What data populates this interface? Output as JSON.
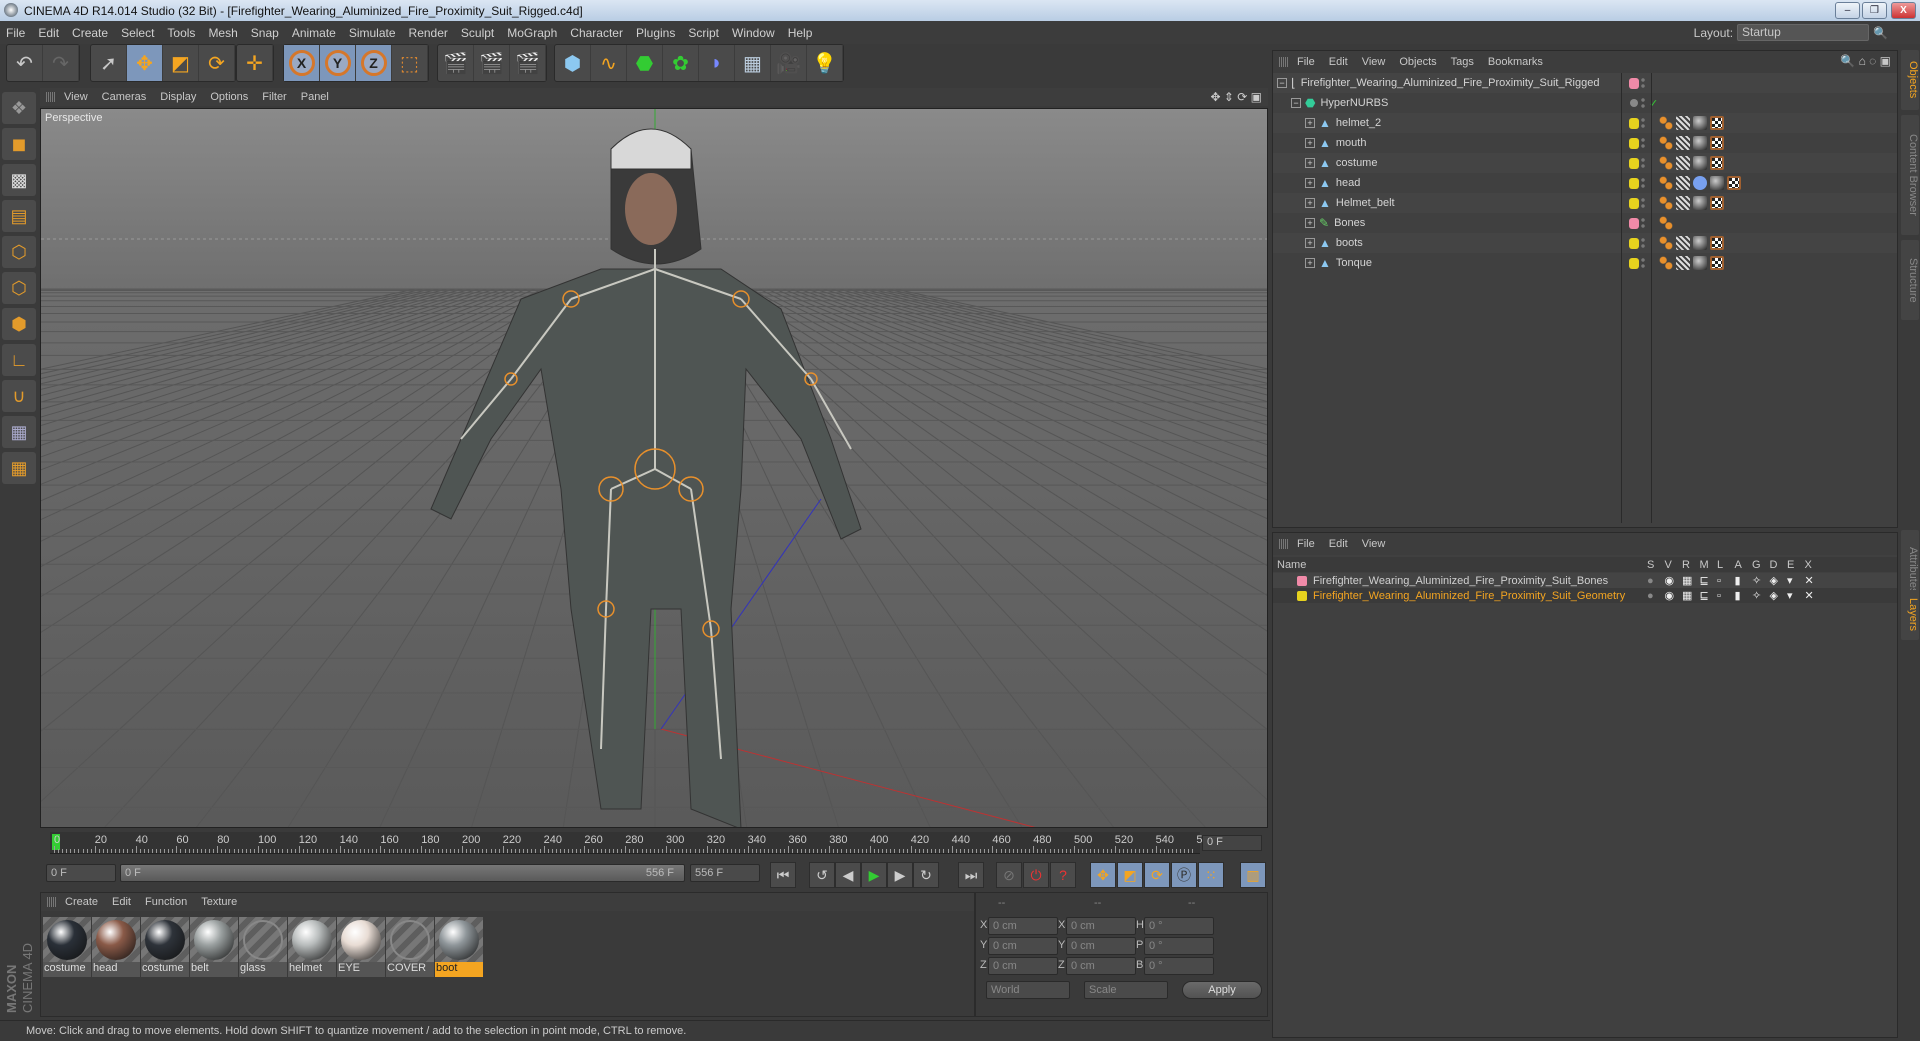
{
  "window": {
    "title": "CINEMA 4D R14.014 Studio (32 Bit) - [Firefighter_Wearing_Aluminized_Fire_Proximity_Suit_Rigged.c4d]",
    "minimize": "‒",
    "restore": "❐",
    "close": "X"
  },
  "menu": [
    "File",
    "Edit",
    "Create",
    "Select",
    "Tools",
    "Mesh",
    "Snap",
    "Animate",
    "Simulate",
    "Render",
    "Sculpt",
    "MoGraph",
    "Character",
    "Plugins",
    "Script",
    "Window",
    "Help"
  ],
  "layout": {
    "label": "Layout:",
    "value": "Startup"
  },
  "toolbar": {
    "axes": [
      "X",
      "Y",
      "Z"
    ]
  },
  "viewport": {
    "menu": [
      "View",
      "Cameras",
      "Display",
      "Options",
      "Filter",
      "Panel"
    ],
    "label": "Perspective"
  },
  "timeline": {
    "ticks": [
      "0",
      "20",
      "40",
      "60",
      "80",
      "100",
      "120",
      "140",
      "160",
      "180",
      "200",
      "220",
      "240",
      "260",
      "280",
      "300",
      "320",
      "340",
      "360",
      "380",
      "400",
      "420",
      "440",
      "460",
      "480",
      "500",
      "520",
      "540",
      "5"
    ],
    "current": "0 F",
    "start": "0 F",
    "range_start": "0 F",
    "range_end": "556 F",
    "end": "556 F"
  },
  "materials": {
    "menu": [
      "Create",
      "Edit",
      "Function",
      "Texture"
    ],
    "items": [
      {
        "name": "costume",
        "color": "#2a3038"
      },
      {
        "name": "head",
        "color": "#8a5a48"
      },
      {
        "name": "costume",
        "color": "#2e333a"
      },
      {
        "name": "belt",
        "color": "#9aa0a0"
      },
      {
        "name": "glass",
        "color": ""
      },
      {
        "name": "helmet",
        "color": "#b8bcbc"
      },
      {
        "name": "EYE",
        "color": "#e8dcd4"
      },
      {
        "name": "COVER",
        "color": ""
      },
      {
        "name": "boot",
        "color": "#8f969a",
        "selected": true
      }
    ]
  },
  "coords": {
    "headers": [
      "--",
      "--",
      "--"
    ],
    "rows": [
      {
        "a": "X",
        "av": "0 cm",
        "b": "X",
        "bv": "0 cm",
        "c": "H",
        "cv": "0 °"
      },
      {
        "a": "Y",
        "av": "0 cm",
        "b": "Y",
        "bv": "0 cm",
        "c": "P",
        "cv": "0 °"
      },
      {
        "a": "Z",
        "av": "0 cm",
        "b": "Z",
        "bv": "0 cm",
        "c": "B",
        "cv": "0 °"
      }
    ],
    "mode": "World",
    "type": "Scale",
    "apply": "Apply"
  },
  "status": "Move: Click and drag to move elements. Hold down SHIFT to quantize movement / add to the selection in point mode, CTRL to remove.",
  "logo": "MAXON CINEMA 4D",
  "objects": {
    "menu": [
      "File",
      "Edit",
      "View",
      "Objects",
      "Tags",
      "Bookmarks"
    ],
    "root": "Firefighter_Wearing_Aluminized_Fire_Proximity_Suit_Rigged",
    "nurbs": "HyperNURBS",
    "items": [
      {
        "name": "helmet_2",
        "layer": "#e6d21e"
      },
      {
        "name": "mouth",
        "layer": "#e6d21e"
      },
      {
        "name": "costume",
        "layer": "#e6d21e"
      },
      {
        "name": "head",
        "layer": "#e6d21e"
      },
      {
        "name": "Helmet_belt",
        "layer": "#e6d21e"
      },
      {
        "name": "Bones",
        "layer": "#f08aa8"
      },
      {
        "name": "boots",
        "layer": "#e6d21e"
      },
      {
        "name": "Tonque",
        "layer": "#e6d21e"
      }
    ]
  },
  "layers": {
    "menu": [
      "File",
      "Edit",
      "View"
    ],
    "name_header": "Name",
    "cols": [
      "S",
      "V",
      "R",
      "M",
      "L",
      "A",
      "G",
      "D",
      "E",
      "X"
    ],
    "items": [
      {
        "name": "Firefighter_Wearing_Aluminized_Fire_Proximity_Suit_Bones",
        "color": "#f08aa8",
        "text": "#d0d0d0"
      },
      {
        "name": "Firefighter_Wearing_Aluminized_Fire_Proximity_Suit_Geometry",
        "color": "#e6d21e",
        "text": "#f4a521"
      }
    ]
  },
  "side_tabs": [
    "Objects",
    "Content Browser",
    "Structure",
    "Attributes",
    "Layers"
  ]
}
